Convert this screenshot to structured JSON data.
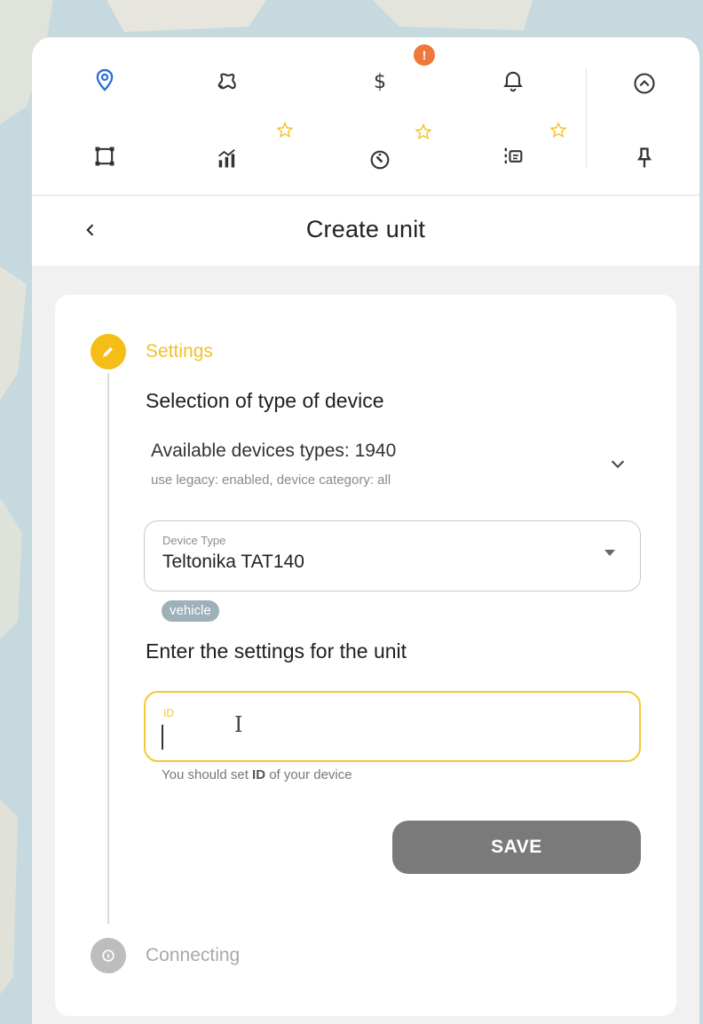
{
  "toolbar": {
    "row1": [
      "location-pin-icon",
      "route-icon",
      "dollar-icon",
      "bell-icon"
    ],
    "row2": [
      "geofence-icon",
      "reports-icon",
      "service-icon",
      "tasks-icon"
    ],
    "right": [
      "collapse-up-icon",
      "pin-icon"
    ],
    "billing_badge": "!",
    "accent_color": "#2e6fd8"
  },
  "header": {
    "title": "Create unit"
  },
  "steps": {
    "settings_label": "Settings",
    "connecting_label": "Connecting",
    "active_color": "#f5be16"
  },
  "device_selection": {
    "title": "Selection of type of device",
    "available": "Available devices types: 1940",
    "available_sub": "use legacy: enabled, device category: all",
    "select_label": "Device Type",
    "select_value": "Teltonika TAT140",
    "chip": "vehicle"
  },
  "unit_settings": {
    "title": "Enter the settings for the unit",
    "id_label": "ID",
    "id_value": "",
    "helper_prefix": "You should set ",
    "helper_bold": "ID",
    "helper_suffix": " of your device",
    "save_label": "SAVE"
  }
}
